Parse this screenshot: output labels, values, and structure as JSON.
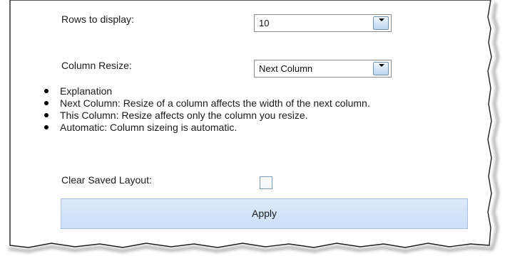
{
  "settings": {
    "rows_label": "Rows to display:",
    "rows_value": "10",
    "resize_label": "Column Resize:",
    "resize_value": "Next Column",
    "explanation": [
      "Explanation",
      "Next Column: Resize of a column affects the width of the next column.",
      "This Column: Resize affects only the column you resize.",
      "Automatic: Column sizeing is automatic."
    ],
    "clear_label": "Clear Saved Layout:",
    "clear_checked": false,
    "apply_label": "Apply"
  },
  "icons": {
    "dropdown": "chevron-down-icon",
    "bullet": "bullet-icon"
  },
  "colors": {
    "button_fill": "#d4e5f9",
    "button_border": "#a8c2e0"
  }
}
